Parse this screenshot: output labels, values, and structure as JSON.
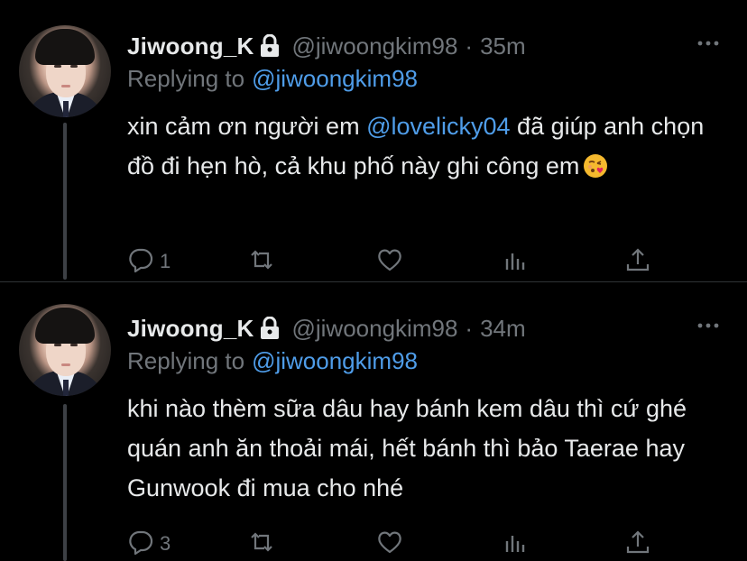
{
  "thread": {
    "tweets": [
      {
        "display_name": "Jiwoong_K",
        "handle": "@jiwoongkim98",
        "separator": "·",
        "time": "35m",
        "reply_prefix": "Replying to",
        "reply_handle": "@jiwoongkim98",
        "text_before": "xin cảm ơn người em ",
        "mention": "@lovelicky04",
        "text_after": " đã giúp anh chọn đồ đi hẹn hò, cả khu phố này ghi công em",
        "emoji": "face-blowing-kiss-emoji",
        "reply_count": "1",
        "icons": [
          "lock-icon",
          "more-icon",
          "reply-icon",
          "retweet-icon",
          "like-icon",
          "analytics-icon",
          "share-icon"
        ]
      },
      {
        "display_name": "Jiwoong_K",
        "handle": "@jiwoongkim98",
        "separator": "·",
        "time": "34m",
        "reply_prefix": "Replying to",
        "reply_handle": "@jiwoongkim98",
        "text_before": "khi nào thèm sữa dâu hay bánh kem dâu thì cứ ghé quán anh ăn thoải mái, hết bánh thì bảo Taerae hay Gunwook đi mua cho nhé",
        "mention": "",
        "text_after": "",
        "emoji": "",
        "reply_count": "3",
        "icons": [
          "lock-icon",
          "more-icon",
          "reply-icon",
          "retweet-icon",
          "like-icon",
          "analytics-icon",
          "share-icon"
        ]
      }
    ]
  },
  "colors": {
    "background": "#000000",
    "primary_text": "#e7e9ea",
    "secondary_text": "#71767b",
    "link": "#4f9de9",
    "thread_line": "#3d4045"
  }
}
